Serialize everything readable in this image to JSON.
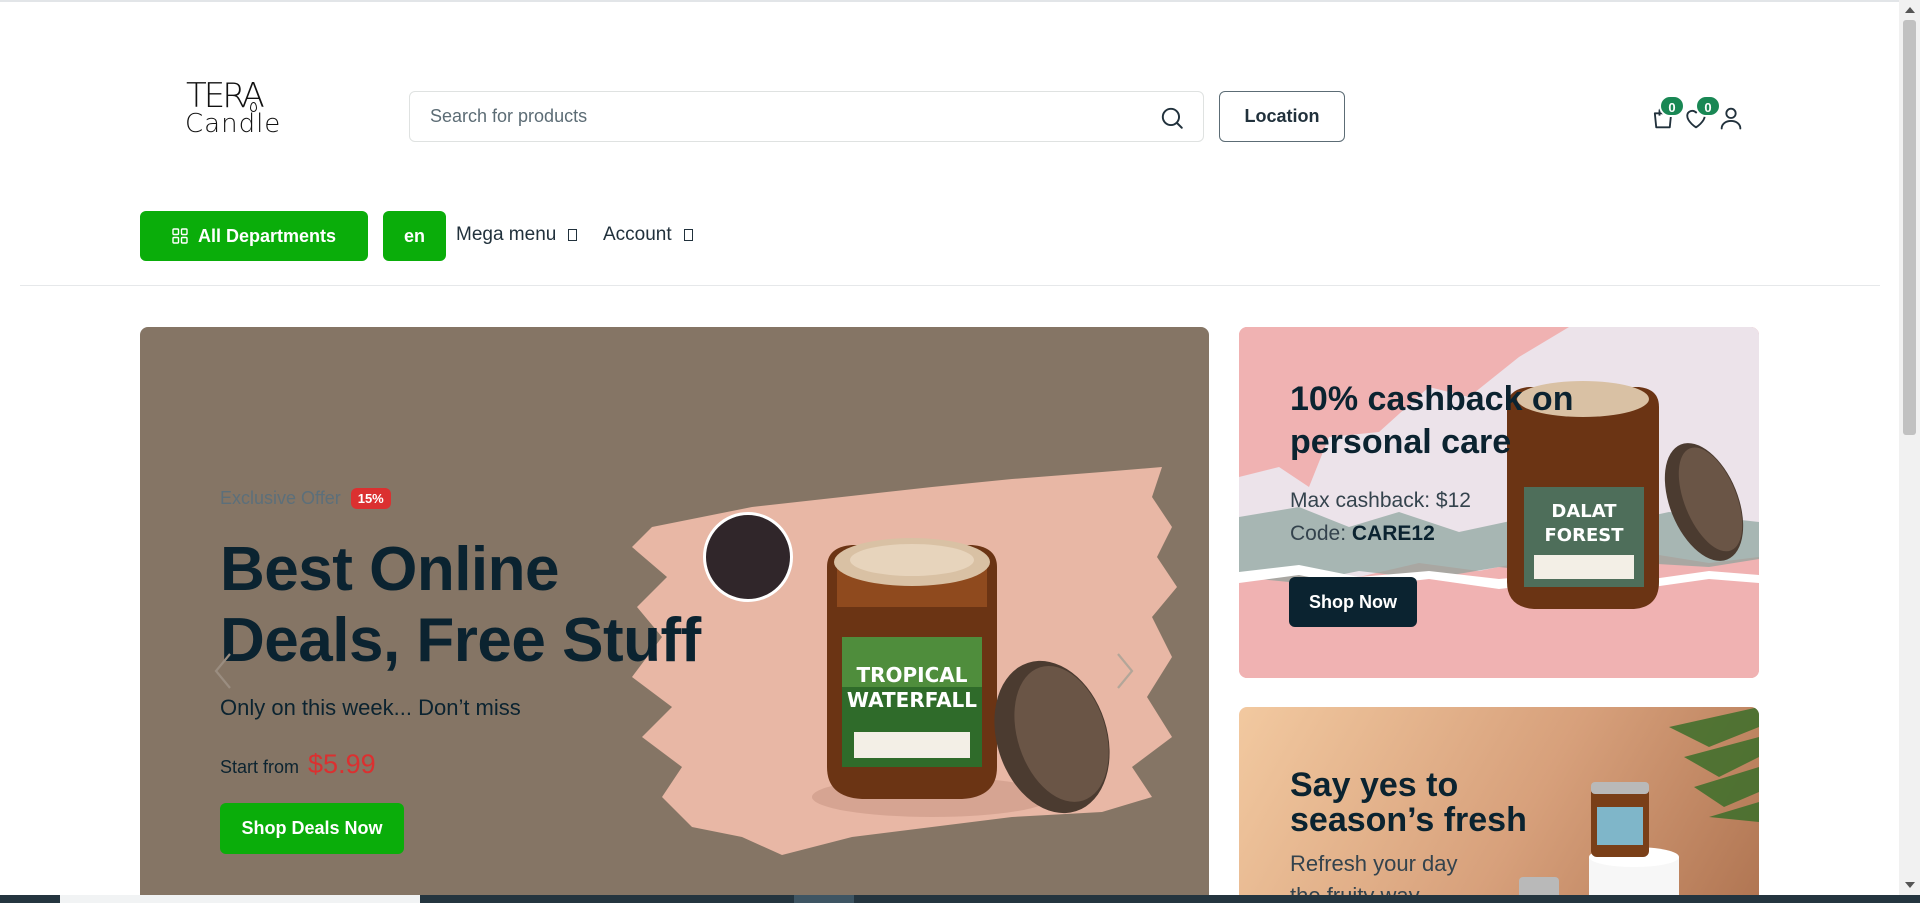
{
  "logo": {
    "line1": "TERA",
    "line2": "Candle"
  },
  "search": {
    "placeholder": "Search for products",
    "value": ""
  },
  "header": {
    "location_label": "Location",
    "cart_count": "0",
    "wishlist_count": "0",
    "icons": [
      "search-icon",
      "cart-icon",
      "heart-icon",
      "user-icon"
    ]
  },
  "nav": {
    "departments_label": "All Departments",
    "language_label": "en",
    "links": [
      {
        "label": "Mega menu"
      },
      {
        "label": "Account"
      }
    ]
  },
  "hero": {
    "offer_label": "Exclusive Offer",
    "discount_badge": "15%",
    "title": "Best Online Deals, Free Stuff",
    "subtitle": "Only on this week... Don’t miss",
    "start_from_label": "Start from",
    "price": "$5.99",
    "cta_label": "Shop Deals Now",
    "jar_label_line1": "TROPICAL",
    "jar_label_line2": "WATERFALL"
  },
  "promo_cards": [
    {
      "title": "10% cashback on personal care",
      "line1": "Max cashback: $12",
      "code_label": "Code:",
      "code": "CARE12",
      "cta_label": "Shop Now",
      "jar_label_line1": "DALAT",
      "jar_label_line2": "FOREST"
    },
    {
      "title": "Say yes to season’s fresh",
      "line1": "Refresh your day",
      "line2": "the fruity way"
    }
  ],
  "colors": {
    "brand_green": "#0aad0a",
    "badge_green": "#198754",
    "sale_red": "#db3030",
    "dark_navy": "#0b2330",
    "hero_bg": "#857565",
    "card1_bg": "#f0b2b2"
  }
}
